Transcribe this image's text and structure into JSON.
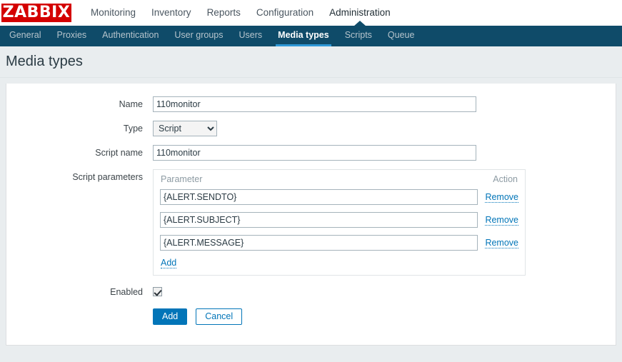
{
  "brand": {
    "logo_text": "ZABBIX",
    "logo_color": "#d40000"
  },
  "topnav": {
    "items": [
      {
        "label": "Monitoring",
        "active": false
      },
      {
        "label": "Inventory",
        "active": false
      },
      {
        "label": "Reports",
        "active": false
      },
      {
        "label": "Configuration",
        "active": false
      },
      {
        "label": "Administration",
        "active": true
      }
    ]
  },
  "subnav": {
    "background": "#0f4b69",
    "accent": "#2e98d6",
    "items": [
      {
        "label": "General",
        "active": false
      },
      {
        "label": "Proxies",
        "active": false
      },
      {
        "label": "Authentication",
        "active": false
      },
      {
        "label": "User groups",
        "active": false
      },
      {
        "label": "Users",
        "active": false
      },
      {
        "label": "Media types",
        "active": true
      },
      {
        "label": "Scripts",
        "active": false
      },
      {
        "label": "Queue",
        "active": false
      }
    ]
  },
  "page": {
    "title": "Media types"
  },
  "form": {
    "name": {
      "label": "Name",
      "value": "110monitor",
      "placeholder": ""
    },
    "type": {
      "label": "Type",
      "value": "Script",
      "options": [
        "Script"
      ]
    },
    "script_name": {
      "label": "Script name",
      "value": "110monitor",
      "placeholder": ""
    },
    "script_parameters": {
      "label": "Script parameters",
      "columns": [
        "Parameter",
        "Action"
      ],
      "rows": [
        {
          "value": "{ALERT.SENDTO}",
          "action_label": "Remove"
        },
        {
          "value": "{ALERT.SUBJECT}",
          "action_label": "Remove"
        },
        {
          "value": "{ALERT.MESSAGE}",
          "action_label": "Remove"
        }
      ],
      "add_label": "Add"
    },
    "enabled": {
      "label": "Enabled",
      "checked": true
    },
    "actions": {
      "submit_label": "Add",
      "cancel_label": "Cancel",
      "primary_color": "#0275b8"
    }
  }
}
